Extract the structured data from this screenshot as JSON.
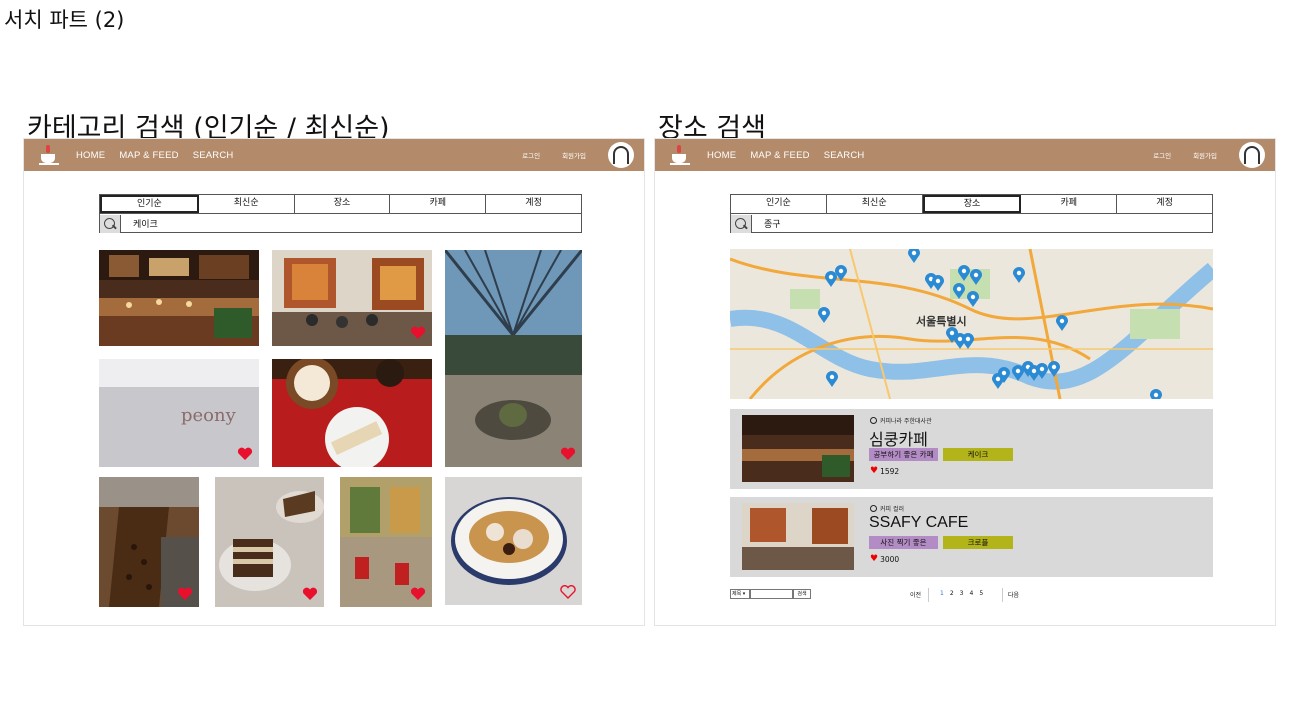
{
  "page_title": "서치 파트 (2)",
  "left_panel": {
    "heading": "카테고리 검색 (인기순 / 최신순)",
    "nav": {
      "home": "HOME",
      "map_feed": "MAP & FEED",
      "search": "SEARCH",
      "login": "로그인",
      "signup": "회원가입"
    },
    "tabs": [
      "인기순",
      "최신순",
      "장소",
      "카페",
      "계정"
    ],
    "active_tab": "인기순",
    "search_value": "케이크",
    "photos": [
      {
        "subject": "cafe-interior-counter",
        "liked": false
      },
      {
        "subject": "cafe-seating-painting",
        "liked": true
      },
      {
        "subject": "glass-roof-garden",
        "liked": true
      },
      {
        "subject": "peony-cake-box",
        "liked": true
      },
      {
        "subject": "drink-and-cake-plate",
        "liked": false
      },
      {
        "subject": "coffee-roaster-beans",
        "liked": true
      },
      {
        "subject": "layered-chocolate-cake",
        "liked": true
      },
      {
        "subject": "red-chairs-cafe",
        "liked": true
      },
      {
        "subject": "waffle-with-cream",
        "liked": false
      }
    ]
  },
  "right_panel": {
    "heading": "장소 검색",
    "nav": {
      "home": "HOME",
      "map_feed": "MAP & FEED",
      "search": "SEARCH",
      "login": "로그인",
      "signup": "회원가입"
    },
    "tabs": [
      "인기순",
      "최신순",
      "장소",
      "카페",
      "계정"
    ],
    "active_tab": "장소",
    "search_value": "종구",
    "map": {
      "city_label": "서울특별시",
      "marker_color": "#2a8ad4"
    },
    "results": [
      {
        "owner": "커피나라 주한대사관",
        "name": "심쿵카페",
        "tag1": "공부하기 좋은 카페",
        "tag2": "케이크",
        "likes": "1592"
      },
      {
        "owner": "커피 컬러",
        "name": "SSAFY CAFE",
        "tag1": "사진 찍기 좋은",
        "tag2": "크로플",
        "likes": "3000"
      }
    ],
    "pager": {
      "sort": "제목 ▾",
      "search_btn": "검색",
      "prev": "이전",
      "pages": [
        "1",
        "2",
        "3",
        "4",
        "5"
      ],
      "current": "1",
      "next": "다음"
    }
  },
  "colors": {
    "navbar": "#b38b6a",
    "tag_purple": "#b48cc5",
    "tag_olive": "#b3b31a",
    "heart": "#e8102c",
    "card_bg": "#d9d9d9"
  }
}
